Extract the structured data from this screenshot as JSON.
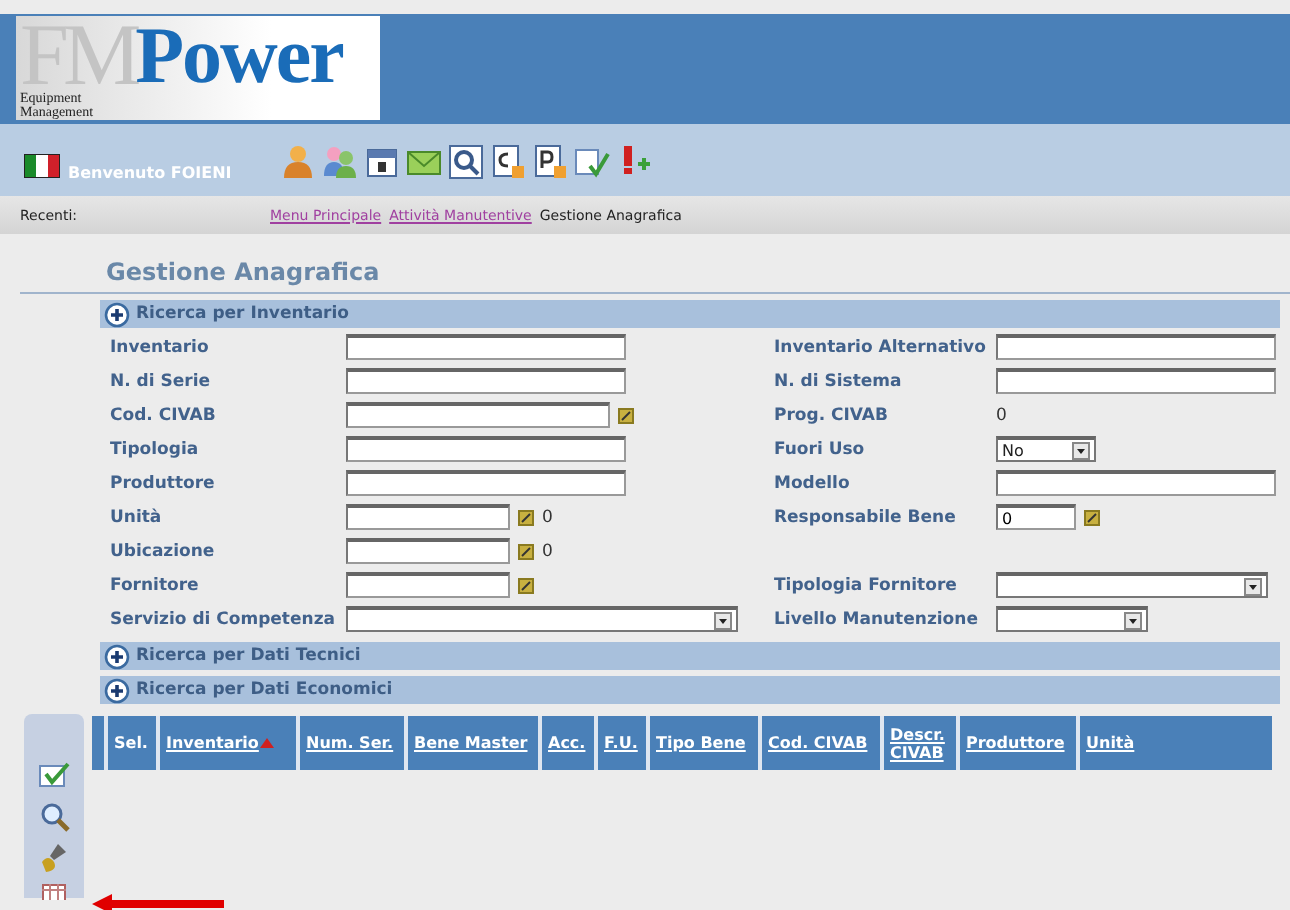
{
  "logo": {
    "mark": "FM",
    "name": "Power",
    "subtitle": [
      "Equipment",
      "Management"
    ]
  },
  "user_bar": {
    "greeting": "Benvenuto FOIENI"
  },
  "breadcrumb": {
    "label": "Recenti:",
    "items": [
      {
        "text": "Menu Principale",
        "kind": "link"
      },
      {
        "text": "Attività Manutentive",
        "kind": "link"
      },
      {
        "text": "Gestione Anagrafica",
        "kind": "current"
      }
    ]
  },
  "page_title": "Gestione Anagrafica",
  "sections": [
    {
      "title": "Ricerca per Inventario"
    },
    {
      "title": "Ricerca per Dati Tecnici"
    },
    {
      "title": "Ricerca per Dati Economici"
    }
  ],
  "form_rows": [
    {
      "left": {
        "label": "Inventario",
        "kind": "text"
      },
      "right": {
        "label": "Inventario Alternativo",
        "kind": "text"
      }
    },
    {
      "left": {
        "label": "N. di Serie",
        "kind": "text"
      },
      "right": {
        "label": "N. di Sistema",
        "kind": "text"
      }
    },
    {
      "left": {
        "label": "Cod. CIVAB",
        "kind": "lookup"
      },
      "right": {
        "label": "Prog. CIVAB",
        "kind": "value",
        "value": "0"
      }
    },
    {
      "left": {
        "label": "Tipologia",
        "kind": "text"
      },
      "right": {
        "label": "Fuori Uso",
        "kind": "select",
        "value": "No"
      }
    },
    {
      "left": {
        "label": "Produttore",
        "kind": "text"
      },
      "right": {
        "label": "Modello",
        "kind": "text"
      }
    },
    {
      "left": {
        "label": "Unità",
        "kind": "lookup",
        "count": "0"
      },
      "right": {
        "label": "Responsabile Bene",
        "kind": "lookup",
        "value": "0"
      }
    },
    {
      "left": {
        "label": "Ubicazione",
        "kind": "lookup",
        "count": "0"
      }
    },
    {
      "left": {
        "label": "Fornitore",
        "kind": "lookup"
      },
      "right": {
        "label": "Tipologia Fornitore",
        "kind": "select"
      }
    },
    {
      "left": {
        "label": "Servizio di Competenza",
        "kind": "select"
      },
      "right": {
        "label": "Livello Manutenzione",
        "kind": "select"
      }
    }
  ],
  "table": {
    "columns": [
      {
        "label": "Sel.",
        "link": false,
        "sorted": false
      },
      {
        "label": "Inventario",
        "link": true,
        "sorted": true
      },
      {
        "label": "Num. Ser.",
        "link": true,
        "sorted": false
      },
      {
        "label": "Bene Master",
        "link": true,
        "sorted": false
      },
      {
        "label": "Acc.",
        "link": true,
        "sorted": false
      },
      {
        "label": "F.U.",
        "link": true,
        "sorted": false
      },
      {
        "label": "Tipo Bene",
        "link": true,
        "sorted": false
      },
      {
        "label": "Cod. CIVAB",
        "link": true,
        "sorted": false
      },
      {
        "label": "Descr. CIVAB",
        "link": true,
        "sorted": false
      },
      {
        "label": "Produttore",
        "link": true,
        "sorted": false
      },
      {
        "label": "Unità",
        "link": true,
        "sorted": false
      }
    ]
  }
}
